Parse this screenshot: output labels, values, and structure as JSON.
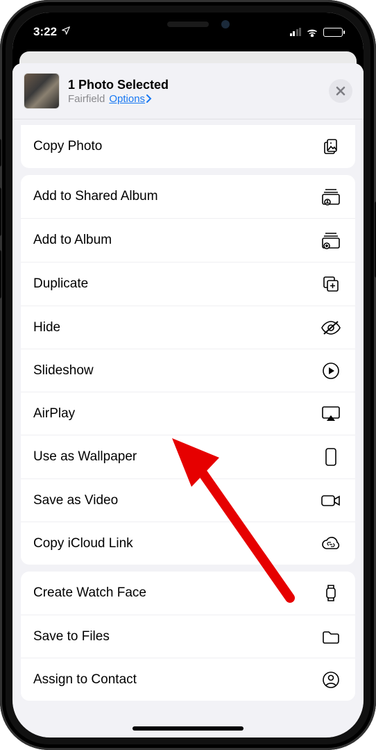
{
  "status": {
    "time": "3:22",
    "location_services": true
  },
  "header": {
    "title": "1 Photo Selected",
    "subtitle_location": "Fairfield",
    "options_label": "Options"
  },
  "groups": [
    {
      "rows": [
        {
          "label": "Copy Photo",
          "icon": "copy-photo"
        }
      ]
    },
    {
      "rows": [
        {
          "label": "Add to Shared Album",
          "icon": "shared-album"
        },
        {
          "label": "Add to Album",
          "icon": "add-album"
        },
        {
          "label": "Duplicate",
          "icon": "duplicate"
        },
        {
          "label": "Hide",
          "icon": "hide"
        },
        {
          "label": "Slideshow",
          "icon": "play-circle"
        },
        {
          "label": "AirPlay",
          "icon": "airplay"
        },
        {
          "label": "Use as Wallpaper",
          "icon": "phone-rect"
        },
        {
          "label": "Save as Video",
          "icon": "video"
        },
        {
          "label": "Copy iCloud Link",
          "icon": "cloud-link"
        }
      ]
    },
    {
      "rows": [
        {
          "label": "Create Watch Face",
          "icon": "watch"
        },
        {
          "label": "Save to Files",
          "icon": "folder"
        },
        {
          "label": "Assign to Contact",
          "icon": "contact"
        }
      ]
    }
  ],
  "annotation": {
    "target_label": "Use as Wallpaper"
  }
}
